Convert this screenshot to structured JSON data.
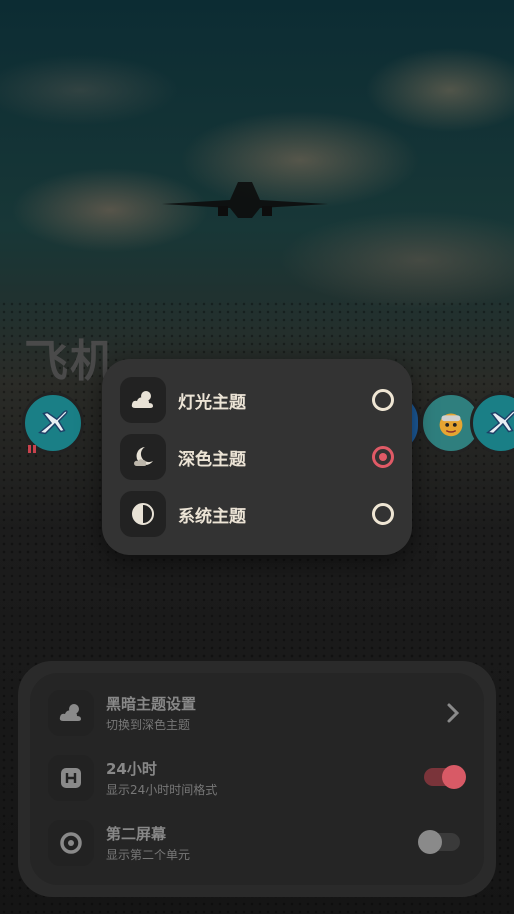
{
  "page": {
    "title": "飞机"
  },
  "theme_menu": {
    "options": [
      {
        "label": "灯光主题",
        "icon": "cloud-sun-icon",
        "selected": false
      },
      {
        "label": "深色主题",
        "icon": "moon-cloud-icon",
        "selected": true
      },
      {
        "label": "系统主题",
        "icon": "half-circle-icon",
        "selected": false
      }
    ]
  },
  "settings": {
    "dark_theme": {
      "title": "黑暗主题设置",
      "subtitle": "切换到深色主题",
      "icon": "cloud-sun-icon"
    },
    "hour24": {
      "title": "24小时",
      "subtitle": "显示24小时时间格式",
      "icon": "h-square-icon",
      "enabled": true
    },
    "second_screen": {
      "title": "第二屏幕",
      "subtitle": "显示第二个单元",
      "icon": "target-icon",
      "enabled": false
    }
  },
  "colors": {
    "accent": "#e05a66",
    "teal": "#1a7f86"
  }
}
